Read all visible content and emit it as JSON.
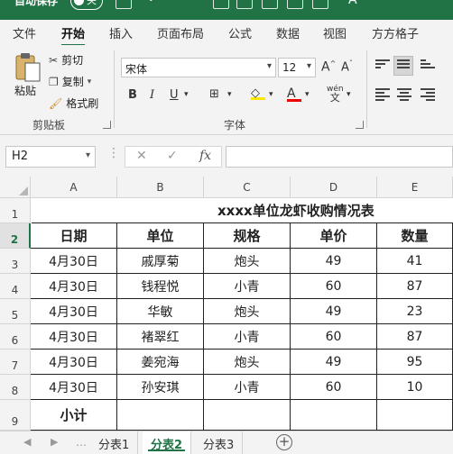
{
  "titlebar": {
    "autosave": "自动保存",
    "toggle": "关"
  },
  "tabs": [
    "文件",
    "开始",
    "插入",
    "页面布局",
    "公式",
    "数据",
    "视图",
    "方方格子"
  ],
  "clipboard": {
    "paste": "粘贴",
    "cut": "剪切",
    "copy": "复制",
    "format_painter": "格式刷",
    "group": "剪贴板"
  },
  "font": {
    "name": "宋体",
    "size": "12",
    "group": "字体",
    "bold": "B",
    "italic": "I",
    "underline": "U",
    "wen": "wén",
    "wen_char": "文"
  },
  "formula_bar": {
    "cell_ref": "H2",
    "fx": "fx",
    "value": ""
  },
  "columns": [
    "A",
    "B",
    "C",
    "D",
    "E"
  ],
  "rows": [
    "1",
    "2",
    "3",
    "4",
    "5",
    "6",
    "7",
    "8",
    "9"
  ],
  "sheet": {
    "title": "xxxx单位龙虾收购情况表",
    "headers": [
      "日期",
      "单位",
      "规格",
      "单价",
      "数量"
    ],
    "data": [
      [
        "4月30日",
        "戚厚菊",
        "炮头",
        "49",
        "41"
      ],
      [
        "4月30日",
        "钱程悦",
        "小青",
        "60",
        "87"
      ],
      [
        "4月30日",
        "华敏",
        "炮头",
        "49",
        "23"
      ],
      [
        "4月30日",
        "褚翠红",
        "小青",
        "60",
        "87"
      ],
      [
        "4月30日",
        "姜宛海",
        "炮头",
        "49",
        "95"
      ],
      [
        "4月30日",
        "孙安琪",
        "小青",
        "60",
        "10"
      ]
    ],
    "subtotal": "小计"
  },
  "sheet_tabs": [
    "分表1",
    "分表2",
    "分表3"
  ],
  "colors": {
    "accent": "#217346"
  }
}
